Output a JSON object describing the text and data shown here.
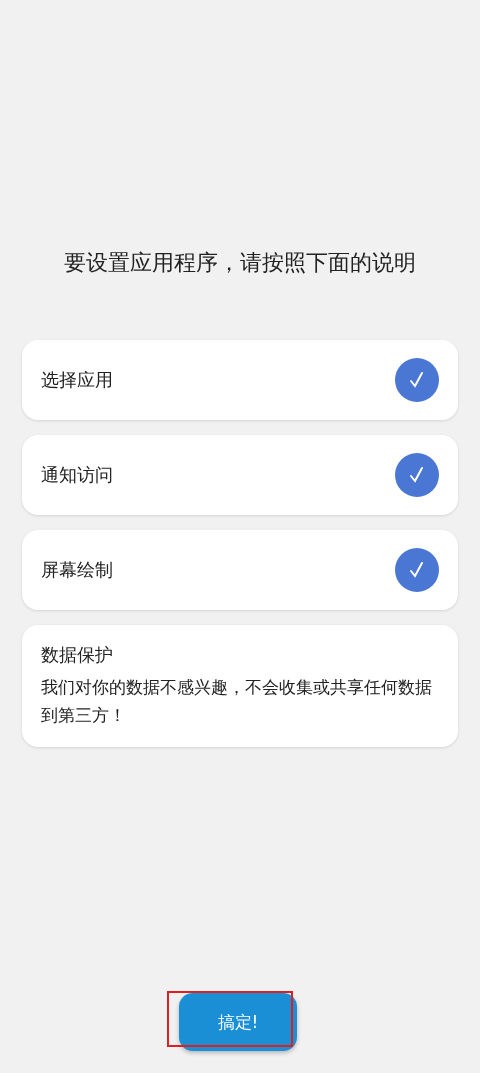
{
  "title": "要设置应用程序，请按照下面的说明",
  "steps": [
    {
      "label": "选择应用",
      "checked": true
    },
    {
      "label": "通知访问",
      "checked": true
    },
    {
      "label": "屏幕绘制",
      "checked": true
    }
  ],
  "notice": {
    "title": "数据保护",
    "body": "我们对你的数据不感兴趣，不会收集或共享任何数据到第三方！"
  },
  "button": {
    "label": "搞定!",
    "highlighted": true
  }
}
